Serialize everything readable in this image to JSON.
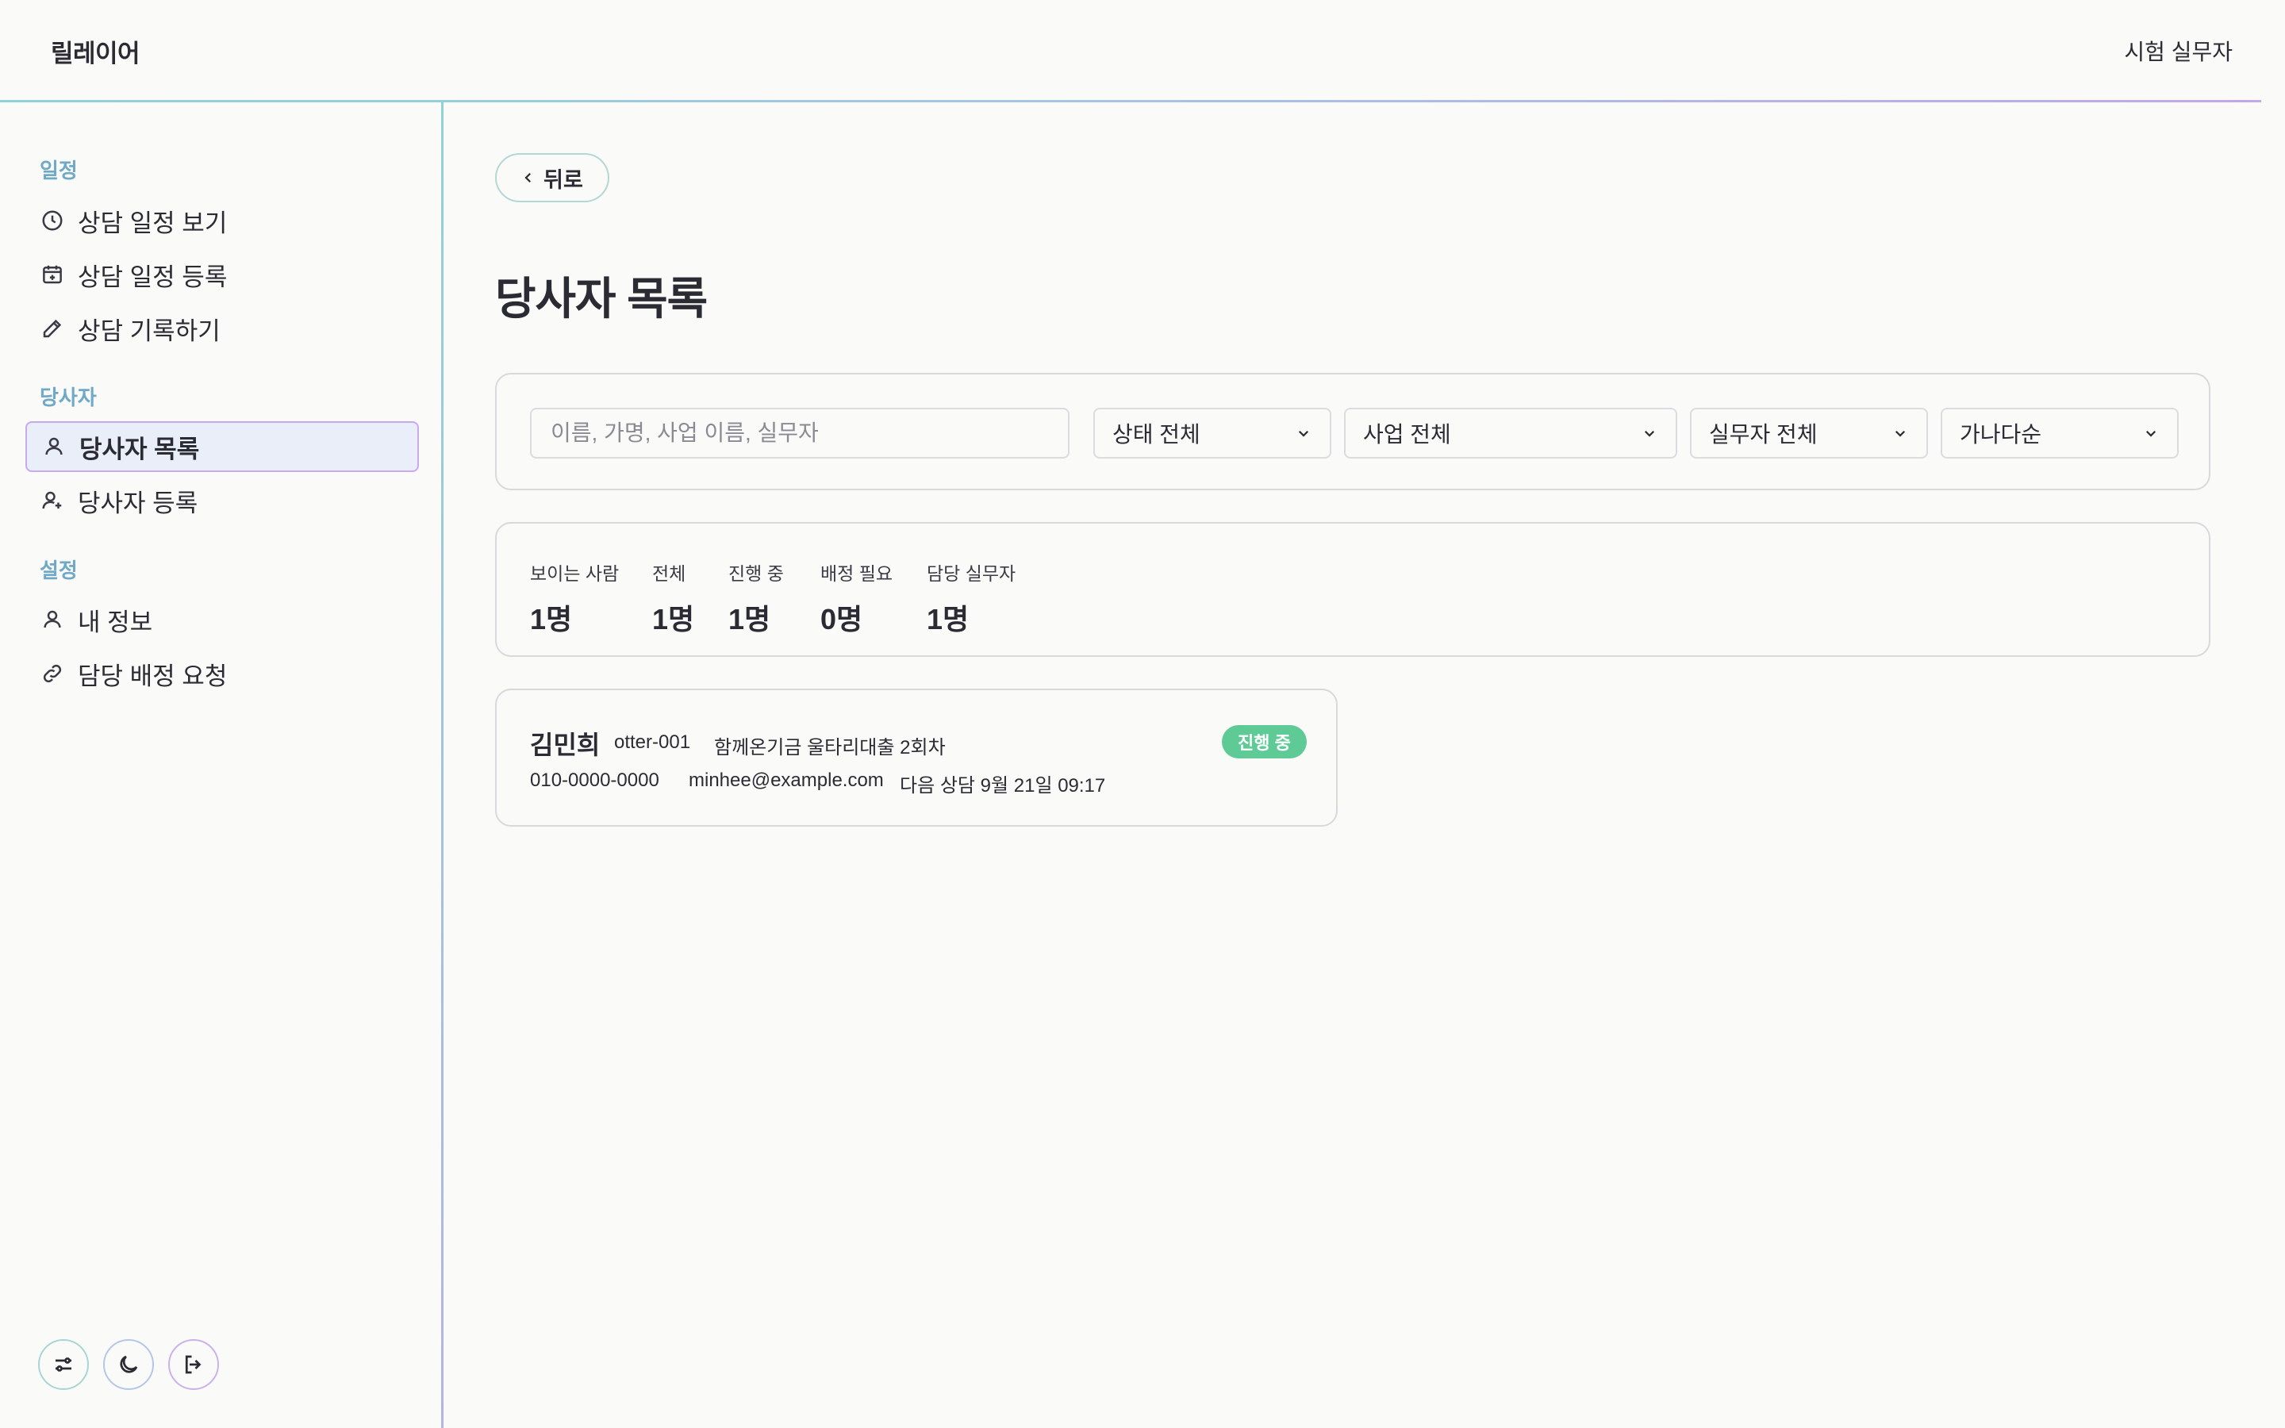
{
  "header": {
    "brand": "릴레이어",
    "user": "시험 실무자"
  },
  "sidebar": {
    "sections": [
      {
        "label": "일정"
      },
      {
        "label": "당사자"
      },
      {
        "label": "설정"
      }
    ],
    "items": [
      {
        "label": "상담 일정 보기",
        "icon": "clock-icon"
      },
      {
        "label": "상담 일정 등록",
        "icon": "calendar-plus-icon"
      },
      {
        "label": "상담 기록하기",
        "icon": "pencil-icon"
      },
      {
        "label": "당사자 목록",
        "icon": "user-icon",
        "active": true
      },
      {
        "label": "당사자 등록",
        "icon": "user-plus-icon"
      },
      {
        "label": "내 정보",
        "icon": "user-icon"
      },
      {
        "label": "담당 배정 요청",
        "icon": "link-icon"
      }
    ],
    "footer": {
      "buttons": [
        "sliders-icon",
        "moon-icon",
        "logout-icon"
      ]
    }
  },
  "main": {
    "back_label": "뒤로",
    "title": "당사자 목록",
    "filters": {
      "search_placeholder": "이름, 가명, 사업 이름, 실무자",
      "status": "상태 전체",
      "program": "사업 전체",
      "worker": "실무자 전체",
      "sort": "가나다순"
    },
    "stats": [
      {
        "label": "보이는 사람",
        "value": "1명"
      },
      {
        "label": "전체",
        "value": "1명"
      },
      {
        "label": "진행 중",
        "value": "1명"
      },
      {
        "label": "배정 필요",
        "value": "0명"
      },
      {
        "label": "담당 실무자",
        "value": "1명"
      }
    ],
    "people": [
      {
        "name": "김민희",
        "id": "otter-001",
        "program": "함께온기금 울타리대출 2회차",
        "status": "진행 중",
        "phone": "010-0000-0000",
        "email": "minhee@example.com",
        "next": "다음 상담 9월 21일 09:17"
      }
    ],
    "status_color": "#5ecb96"
  }
}
